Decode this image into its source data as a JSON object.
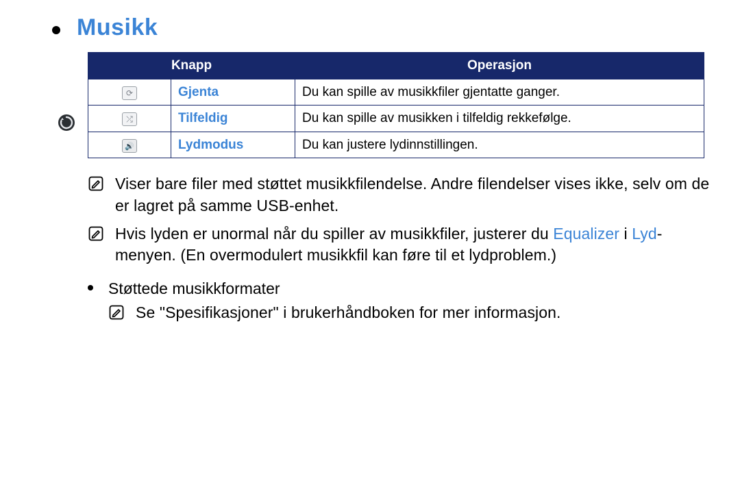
{
  "title": "Musikk",
  "table": {
    "headers": {
      "button": "Knapp",
      "operation": "Operasjon"
    },
    "rows": [
      {
        "icon": "repeat",
        "name": "Gjenta",
        "desc": "Du kan spille av musikkfiler gjentatte ganger."
      },
      {
        "icon": "shuffle",
        "name": "Tilfeldig",
        "desc": "Du kan spille av musikken i tilfeldig rekkefølge."
      },
      {
        "icon": "sound",
        "name": "Lydmodus",
        "desc": "Du kan justere lydinnstillingen."
      }
    ]
  },
  "notes": {
    "n1": "Viser bare filer med støttet musikkfilendelse. Andre filendelser vises ikke, selv om de er lagret på samme USB-enhet.",
    "n2a": "Hvis lyden er unormal når du spiller av musikkfiler, justerer du ",
    "n2_kw1": "Equalizer",
    "n2b": " i ",
    "n2_kw2": "Lyd",
    "n2c": "-menyen. (En overmodulert musikkfil kan føre til et lydproblem.)"
  },
  "sub": {
    "heading": "Støttede musikkformater",
    "note": "Se \"Spesifikasjoner\" i brukerhåndboken for mer informasjon."
  }
}
